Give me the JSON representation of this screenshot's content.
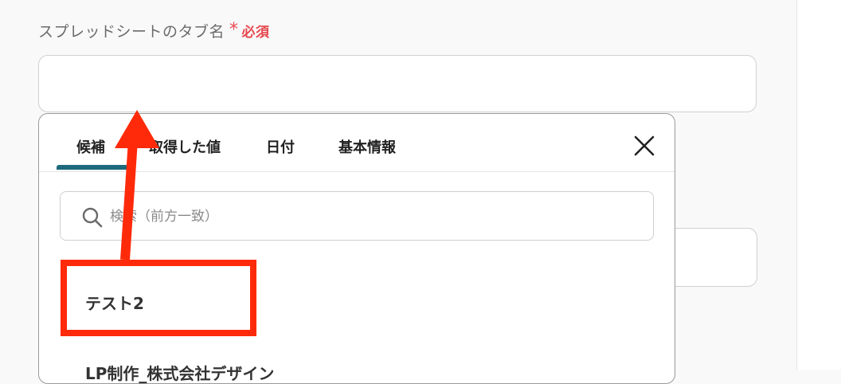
{
  "form": {
    "label": "スプレッドシートのタブ名",
    "required_mark": "*",
    "required_text": "必須",
    "tab_name_value": ""
  },
  "popup": {
    "tabs": [
      {
        "label": "候補",
        "active": true
      },
      {
        "label": "取得した値",
        "active": false
      },
      {
        "label": "日付",
        "active": false
      },
      {
        "label": "基本情報",
        "active": false
      }
    ],
    "search_placeholder": "検索（前方一致）",
    "items": [
      {
        "label": "テスト2"
      },
      {
        "label": "LP制作_株式会社デザイン"
      }
    ],
    "accent_color": "#1d6a7c"
  },
  "annotation": {
    "color": "#ff2a0a"
  },
  "icons": {
    "close": "close-icon",
    "search": "search-icon"
  }
}
